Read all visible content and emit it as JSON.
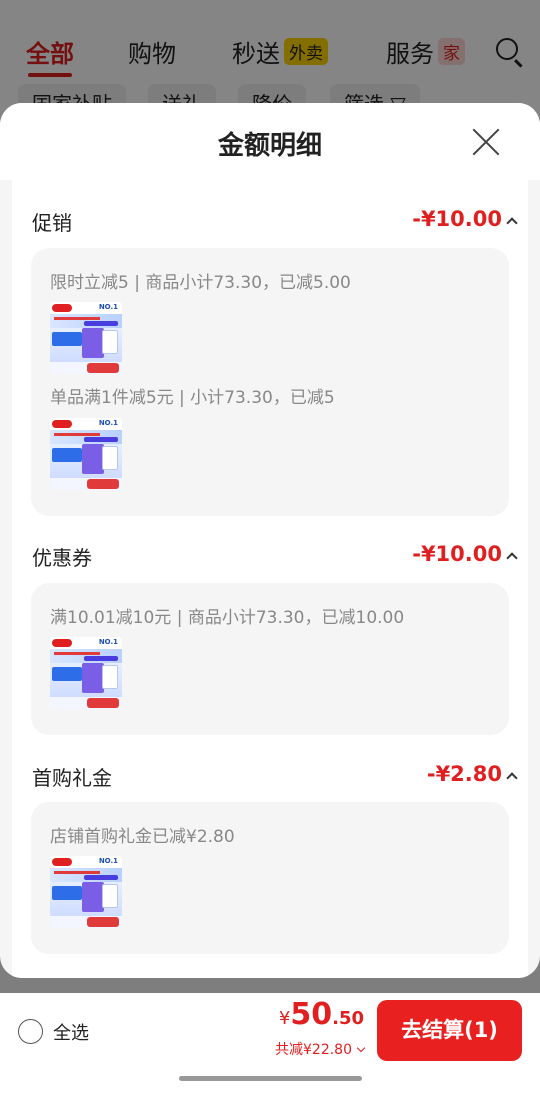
{
  "background": {
    "tabs": [
      {
        "label": "全部"
      },
      {
        "label": "购物"
      },
      {
        "label": "秒送",
        "badge": "外卖"
      },
      {
        "label": "服务",
        "badge": "家"
      }
    ],
    "filters": [
      "国家补贴",
      "送礼",
      "降价",
      "筛选 ▽"
    ]
  },
  "sheet": {
    "title": "金额明细"
  },
  "sections": [
    {
      "title": "促销",
      "amount": "-¥10.00",
      "lines": [
        {
          "text": "限时立减5 | 商品小计73.30，已减5.00"
        },
        {
          "text": "单品满1件减5元 | 小计73.30，已减5"
        }
      ]
    },
    {
      "title": "优惠券",
      "amount": "-¥10.00",
      "lines": [
        {
          "text": "满10.01减10元 | 商品小计73.30，已减10.00"
        }
      ]
    },
    {
      "title": "首购礼金",
      "amount": "-¥2.80",
      "lines": [
        {
          "text": "店铺首购礼金已减¥2.80"
        }
      ]
    }
  ],
  "bottom": {
    "select_all": "全选",
    "currency": "¥",
    "price_int": "50",
    "price_dec": ".50",
    "discount": "共减¥22.80",
    "checkout": "去结算(1)"
  },
  "colors": {
    "accent": "#e02020",
    "checkout_bg": "#e8201f"
  }
}
